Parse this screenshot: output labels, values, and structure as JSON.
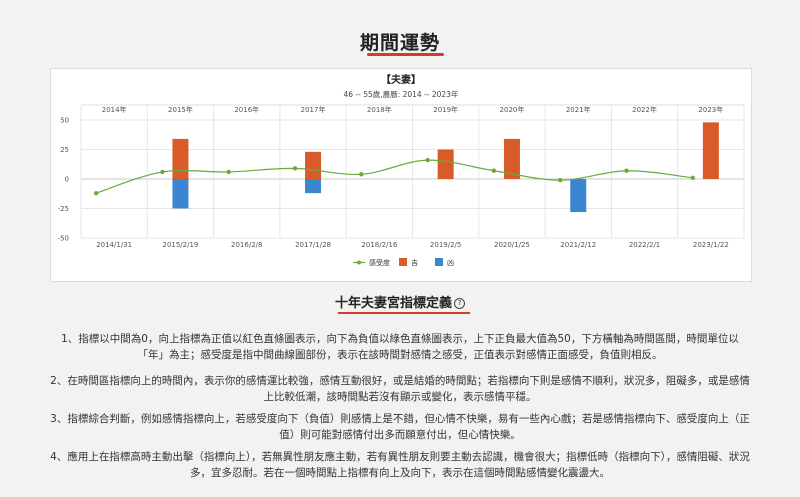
{
  "page": {
    "title": "期間運勢",
    "section_title": "十年夫妻宮指標定義",
    "help_icon": "question-icon",
    "help_glyph": "?"
  },
  "paragraphs": [
    "1、指標以中間為0，向上指標為正值以紅色直條圖表示，向下為負值以綠色直條圖表示，上下正負最大值為50，下方橫軸為時間區間，時間單位以「年」為主；感受度是指中間曲線圖部份，表示在該時間對感情之感受，正值表示對感情正面感受，負值則相反。",
    "2、在時間區指標向上的時間內，表示你的感情運比較強，感情互動很好，或是結婚的時間點；若指標向下則是感情不順利，狀況多，阻礙多，或是感情上比較低潮，該時間點若沒有顯示或變化，表示感情平穩。",
    "3、指標綜合判斷，例如感情指標向上，若感受度向下（負值）則感情上是不錯，但心情不快樂，易有一些內心戲；若是感情指標向下、感受度向上（正值）則可能對感情付出多而願意付出，但心情快樂。",
    "4、應用上在指標高時主動出擊（指標向上），若無異性朋友應主動，若有異性朋友則要主動去認識，機會很大；指標低時（指標向下），感情阻礙、狀況多，宜多忍耐。若在一個時間點上指標有向上及向下，表示在這個時間點感情變化震盪大。"
  ],
  "chart_data": {
    "type": "bar",
    "title": "【夫妻】",
    "subtitle": "46 -- 55歲,農曆: 2014 -- 2023年",
    "top_labels": [
      "2014年",
      "2015年",
      "2016年",
      "2017年",
      "2018年",
      "2019年",
      "2020年",
      "2021年",
      "2022年",
      "2023年"
    ],
    "categories": [
      "2014/1/31",
      "2015/2/19",
      "2016/2/8",
      "2017/1/28",
      "2018/2/16",
      "2019/2/5",
      "2020/1/25",
      "2021/2/12",
      "2022/2/1",
      "2023/1/22"
    ],
    "ylim": [
      -50,
      50
    ],
    "yticks": [
      50,
      25,
      0,
      -25,
      -50
    ],
    "grid": true,
    "legend_position": "bottom",
    "series": [
      {
        "name": "感受度",
        "kind": "line",
        "color": "#6aaa3a",
        "values": [
          -12,
          6,
          6,
          9,
          4,
          16,
          7,
          -1,
          7,
          1
        ]
      },
      {
        "name": "吉",
        "kind": "bar",
        "color": "#d95b2a",
        "values": [
          0,
          34,
          0,
          23,
          0,
          25,
          34,
          0,
          0,
          48
        ]
      },
      {
        "name": "凶",
        "kind": "bar",
        "color": "#3b86cf",
        "values": [
          0,
          -25,
          0,
          -12,
          0,
          0,
          0,
          -28,
          0,
          0
        ]
      }
    ]
  }
}
